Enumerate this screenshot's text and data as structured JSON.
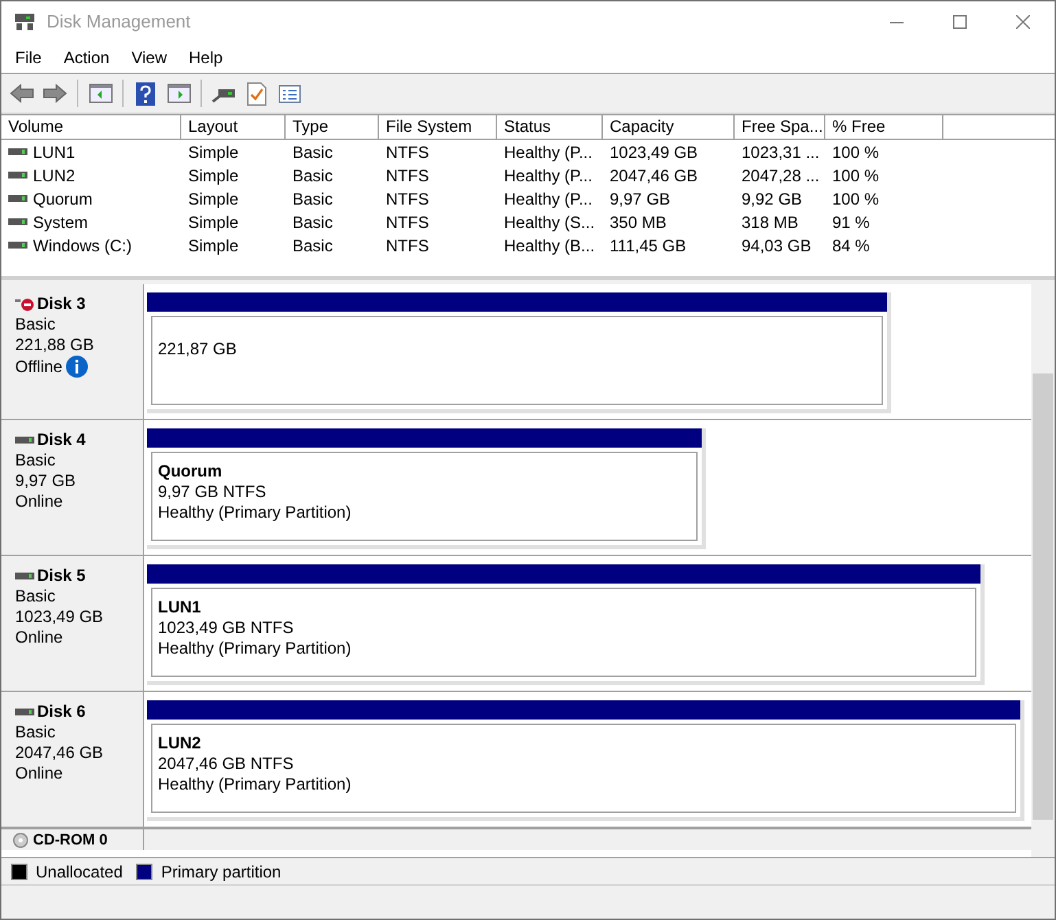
{
  "window": {
    "title": "Disk Management"
  },
  "menu": [
    "File",
    "Action",
    "View",
    "Help"
  ],
  "volumes": {
    "columns": [
      "Volume",
      "Layout",
      "Type",
      "File System",
      "Status",
      "Capacity",
      "Free Spa...",
      "% Free"
    ],
    "rows": [
      [
        "LUN1",
        "Simple",
        "Basic",
        "NTFS",
        "Healthy (P...",
        "1023,49 GB",
        "1023,31 ...",
        "100 %"
      ],
      [
        "LUN2",
        "Simple",
        "Basic",
        "NTFS",
        "Healthy (P...",
        "2047,46 GB",
        "2047,28 ...",
        "100 %"
      ],
      [
        "Quorum",
        "Simple",
        "Basic",
        "NTFS",
        "Healthy (P...",
        "9,97 GB",
        "9,92 GB",
        "100 %"
      ],
      [
        "System",
        "Simple",
        "Basic",
        "NTFS",
        "Healthy (S...",
        "350 MB",
        "318 MB",
        "91 %"
      ],
      [
        "Windows (C:)",
        "Simple",
        "Basic",
        "NTFS",
        "Healthy (B...",
        "111,45 GB",
        "94,03 GB",
        "84 %"
      ]
    ]
  },
  "disks": [
    {
      "name": "Disk 3",
      "type": "Basic",
      "size": "221,88 GB",
      "status": "Offline",
      "offline": true,
      "partition": {
        "lines": [
          "221,87 GB"
        ]
      }
    },
    {
      "name": "Disk 4",
      "type": "Basic",
      "size": "9,97 GB",
      "status": "Online",
      "offline": false,
      "partition": {
        "label": "Quorum",
        "lines": [
          "9,97 GB NTFS",
          "Healthy (Primary Partition)"
        ]
      }
    },
    {
      "name": "Disk 5",
      "type": "Basic",
      "size": "1023,49 GB",
      "status": "Online",
      "offline": false,
      "partition": {
        "label": "LUN1",
        "lines": [
          "1023,49 GB NTFS",
          "Healthy (Primary Partition)"
        ]
      }
    },
    {
      "name": "Disk 6",
      "type": "Basic",
      "size": "2047,46 GB",
      "status": "Online",
      "offline": false,
      "partition": {
        "label": "LUN2",
        "lines": [
          "2047,46 GB NTFS",
          "Healthy (Primary Partition)"
        ]
      }
    }
  ],
  "cdrom": {
    "name": "CD-ROM 0"
  },
  "legend": [
    {
      "label": "Unallocated",
      "color": "#000000"
    },
    {
      "label": "Primary partition",
      "color": "#000080"
    }
  ]
}
